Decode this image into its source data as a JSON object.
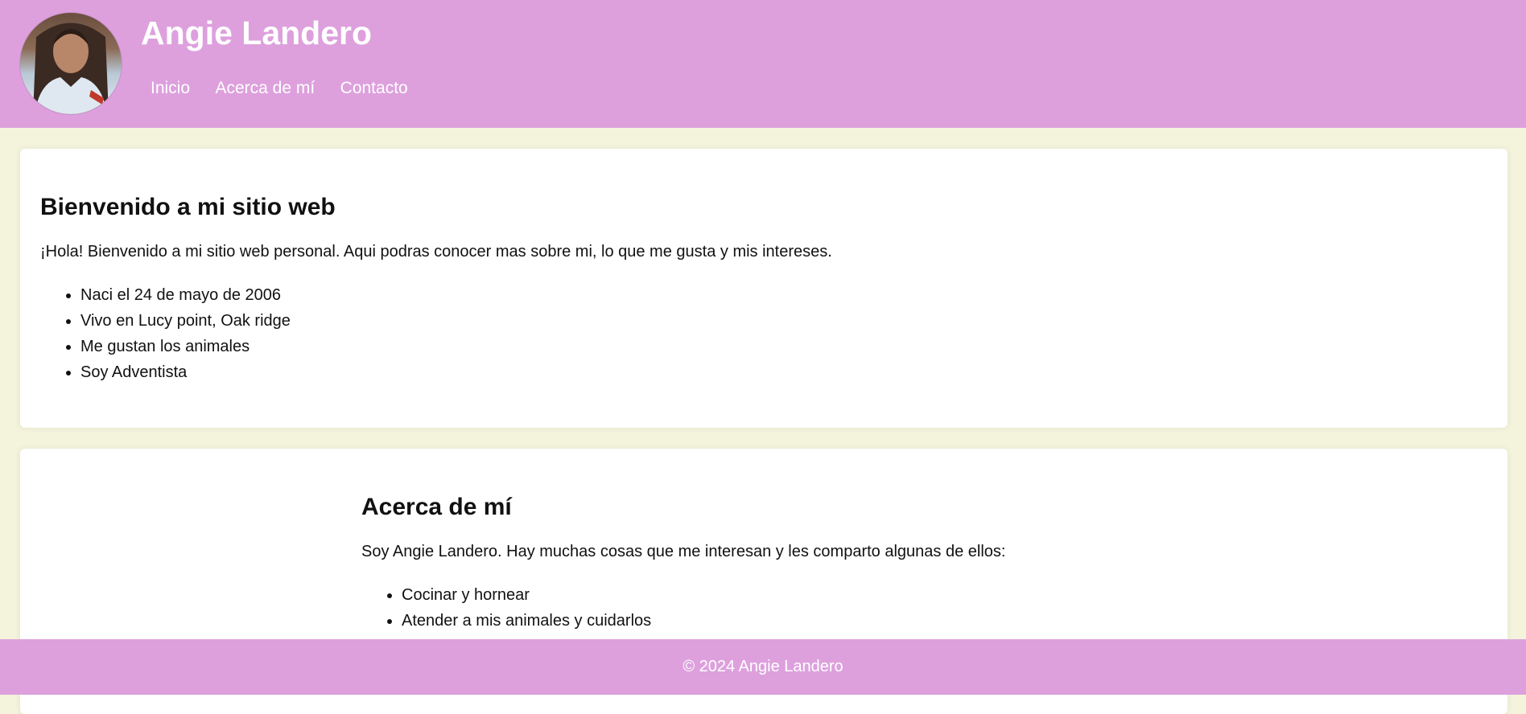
{
  "header": {
    "title": "Angie Landero",
    "avatar_icon": "profile-photo",
    "nav": [
      {
        "label": "Inicio"
      },
      {
        "label": "Acerca de mí"
      },
      {
        "label": "Contacto"
      }
    ]
  },
  "welcome": {
    "heading": "Bienvenido a mi sitio web",
    "intro": "¡Hola! Bienvenido a mi sitio web personal. Aqui podras conocer mas sobre mi, lo que me gusta y mis intereses.",
    "items": [
      "Naci el 24 de mayo de 2006",
      "Vivo en Lucy point, Oak ridge",
      "Me gustan los animales",
      "Soy Adventista"
    ]
  },
  "about": {
    "heading": "Acerca de mí",
    "intro": "Soy Angie Landero. Hay muchas cosas que me interesan y les comparto algunas de ellos:",
    "items": [
      "Cocinar y hornear",
      "Atender a mis animales y cuidarlos"
    ]
  },
  "footer": {
    "text": "© 2024 Angie Landero"
  },
  "colors": {
    "header_bg": "#dda0dd",
    "page_bg": "#f4f4dc",
    "card_bg": "#ffffff"
  }
}
